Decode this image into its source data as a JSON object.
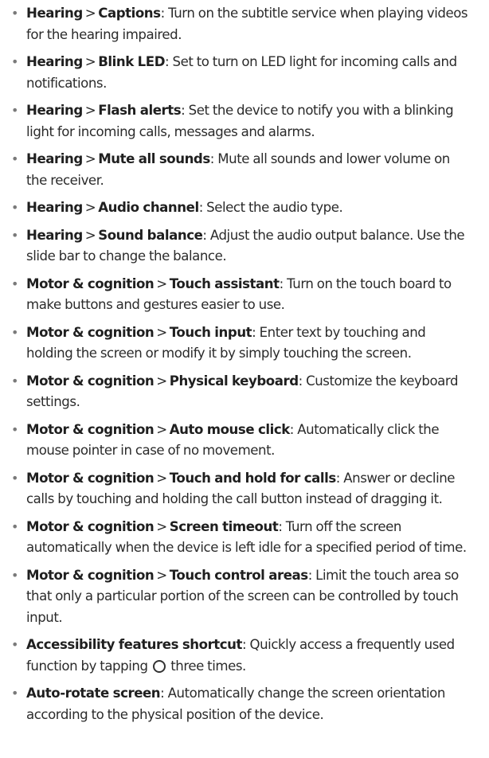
{
  "items": [
    {
      "cat": "Hearing",
      "name": "Captions",
      "desc": ": Turn on the subtitle service when playing videos for the hearing impaired."
    },
    {
      "cat": "Hearing",
      "name": "Blink LED",
      "desc": ": Set to turn on LED light for incoming calls and notifications."
    },
    {
      "cat": "Hearing",
      "name": "Flash alerts",
      "desc": ": Set the device to notify you with a blinking light for incoming calls, messages and alarms."
    },
    {
      "cat": "Hearing",
      "name": "Mute all sounds",
      "desc": ": Mute all sounds and lower volume on the receiver."
    },
    {
      "cat": "Hearing",
      "name": "Audio channel",
      "desc": ": Select the audio type."
    },
    {
      "cat": "Hearing",
      "name": "Sound balance",
      "desc": ": Adjust the audio output balance. Use the slide bar to change the balance."
    },
    {
      "cat": "Motor & cognition",
      "name": "Touch assistant",
      "desc": ": Turn on the touch board to make buttons and gestures easier to use."
    },
    {
      "cat": "Motor & cognition",
      "name": "Touch input",
      "desc": ": Enter text by touching and holding the screen or modify it by simply touching the screen."
    },
    {
      "cat": "Motor & cognition",
      "name": "Physical keyboard",
      "desc": ": Customize the keyboard settings."
    },
    {
      "cat": "Motor & cognition",
      "name": "Auto mouse click",
      "desc": ": Automatically click the mouse pointer in case of no movement."
    },
    {
      "cat": "Motor & cognition",
      "name": "Touch and hold for calls",
      "desc": ": Answer or decline calls by touching and holding the call button instead of dragging it."
    },
    {
      "cat": "Motor & cognition",
      "name": "Screen timeout",
      "desc": ": Turn off the screen automatically when the device is left idle for a specified period of time."
    },
    {
      "cat": "Motor & cognition",
      "name": "Touch control areas",
      "desc": ": Limit the touch area so that only a particular portion of the screen can be controlled by touch input."
    }
  ],
  "shortcut": {
    "name": "Accessibility features shortcut",
    "desc_before": ": Quickly access a frequently used function by tapping",
    "icon": "home-button-circle-icon",
    "desc_after": "three times."
  },
  "autorotate": {
    "name": "Auto-rotate screen",
    "desc": ": Automatically change the screen orientation according to the physical position of the device."
  },
  "separator": ">",
  "bullet": "•"
}
